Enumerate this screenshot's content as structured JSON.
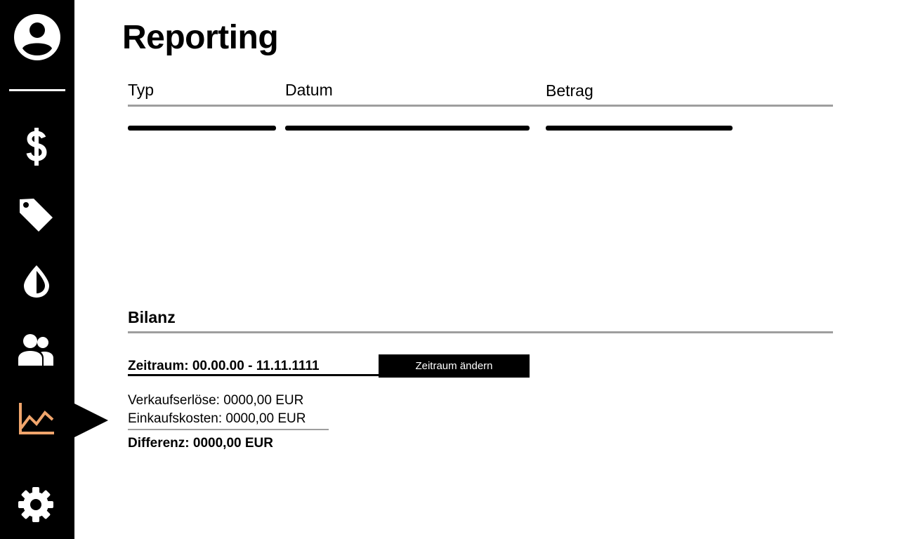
{
  "page": {
    "title": "Reporting"
  },
  "sidebar": {
    "items": [
      {
        "icon": "account-circle-icon"
      },
      {
        "icon": "dollar-icon"
      },
      {
        "icon": "tag-icon"
      },
      {
        "icon": "drop-icon"
      },
      {
        "icon": "group-icon"
      },
      {
        "icon": "chart-icon",
        "active": true
      },
      {
        "icon": "gear-icon"
      }
    ],
    "active_color": "#f0a56c"
  },
  "table": {
    "columns": [
      "Typ",
      "Datum",
      "Betrag"
    ]
  },
  "balance": {
    "title": "Bilanz",
    "period_label": "Zeitraum: 00.00.00 - 11.11.1111",
    "change_period_button": "Zeitraum ändern",
    "revenue": "Verkaufserlöse: 0000,00 EUR",
    "costs": "Einkaufskosten: 0000,00 EUR",
    "difference": "Differenz: 0000,00 EUR"
  }
}
